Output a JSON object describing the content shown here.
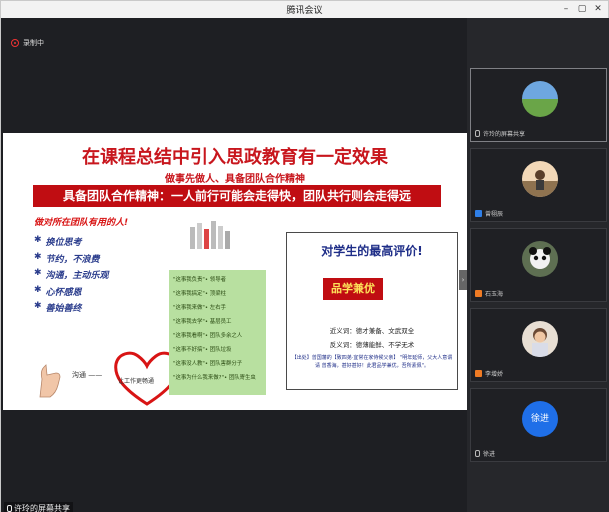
{
  "window": {
    "title": "腾讯会议"
  },
  "recording": {
    "label": "录制中"
  },
  "share_label": "许玲的屏幕共享",
  "slide": {
    "title": "在课程总结中引入思政教育有一定效果",
    "subtitle": "做事先做人、具备团队合作精神",
    "banner": "具备团队合作精神：一人前行可能会走得快，团队共行则会走得远",
    "left_heading": "做对所在团队有用的人!",
    "left_items": [
      "换位思考",
      "节约，不浪费",
      "沟通，主动乐观",
      "心怀感恩",
      "善始善终"
    ],
    "bullet": "✱",
    "goutong": "沟通",
    "heart_text": "让工作更畅通",
    "green_items": [
      "\"这事我负责\"• 领导者",
      "\"这事我搞定\"• 顶梁柱",
      "\"这事我来做\"• 左右手",
      "\"这事我去学\"• 基层员工",
      "\"这事我看啊\"• 团队多余之人",
      "\"这事不好搞\"• 团队垃圾",
      "\"这事没人教\"• 团队害群分子",
      "\"这事为什么我来做?\"• 团队寄生虫"
    ],
    "card": {
      "title": "对学生的最高评价!",
      "badge": "品学兼优",
      "near": "近义词：德才兼备、文武双全",
      "anti": "反义词：德薄能鲜、不学无术",
      "quote": "【出处】曾国藩的【致四弟·宜常在家侍候父亲】 \"明年延师，父大人意谓请 曾香海，甚好甚好！此君品学兼优，吾所素佩\"。"
    }
  },
  "participants": [
    {
      "name": "许玲的屏幕共享",
      "mic": "gray",
      "avatar": "landscape"
    },
    {
      "name": "曾栩辰",
      "mic": "blue",
      "avatar": "person"
    },
    {
      "name": "石玉海",
      "mic": "orange",
      "avatar": "panda"
    },
    {
      "name": "李增娇",
      "mic": "orange",
      "avatar": "child"
    },
    {
      "name": "徐进",
      "mic": "gray",
      "avatar": "text",
      "avatar_text": "徐进"
    }
  ],
  "colors": {
    "accent_red": "#c00d12",
    "title_red": "#c8161d",
    "navy": "#1f2e88",
    "green_panel": "#b8e0a0",
    "meeting_blue": "#1f6fe8"
  },
  "icons": {
    "minimize": "minimize-icon",
    "maximize": "maximize-icon",
    "close": "close-icon",
    "record": "record-icon",
    "mic": "mic-icon",
    "collapse": "chevron-right-icon"
  }
}
